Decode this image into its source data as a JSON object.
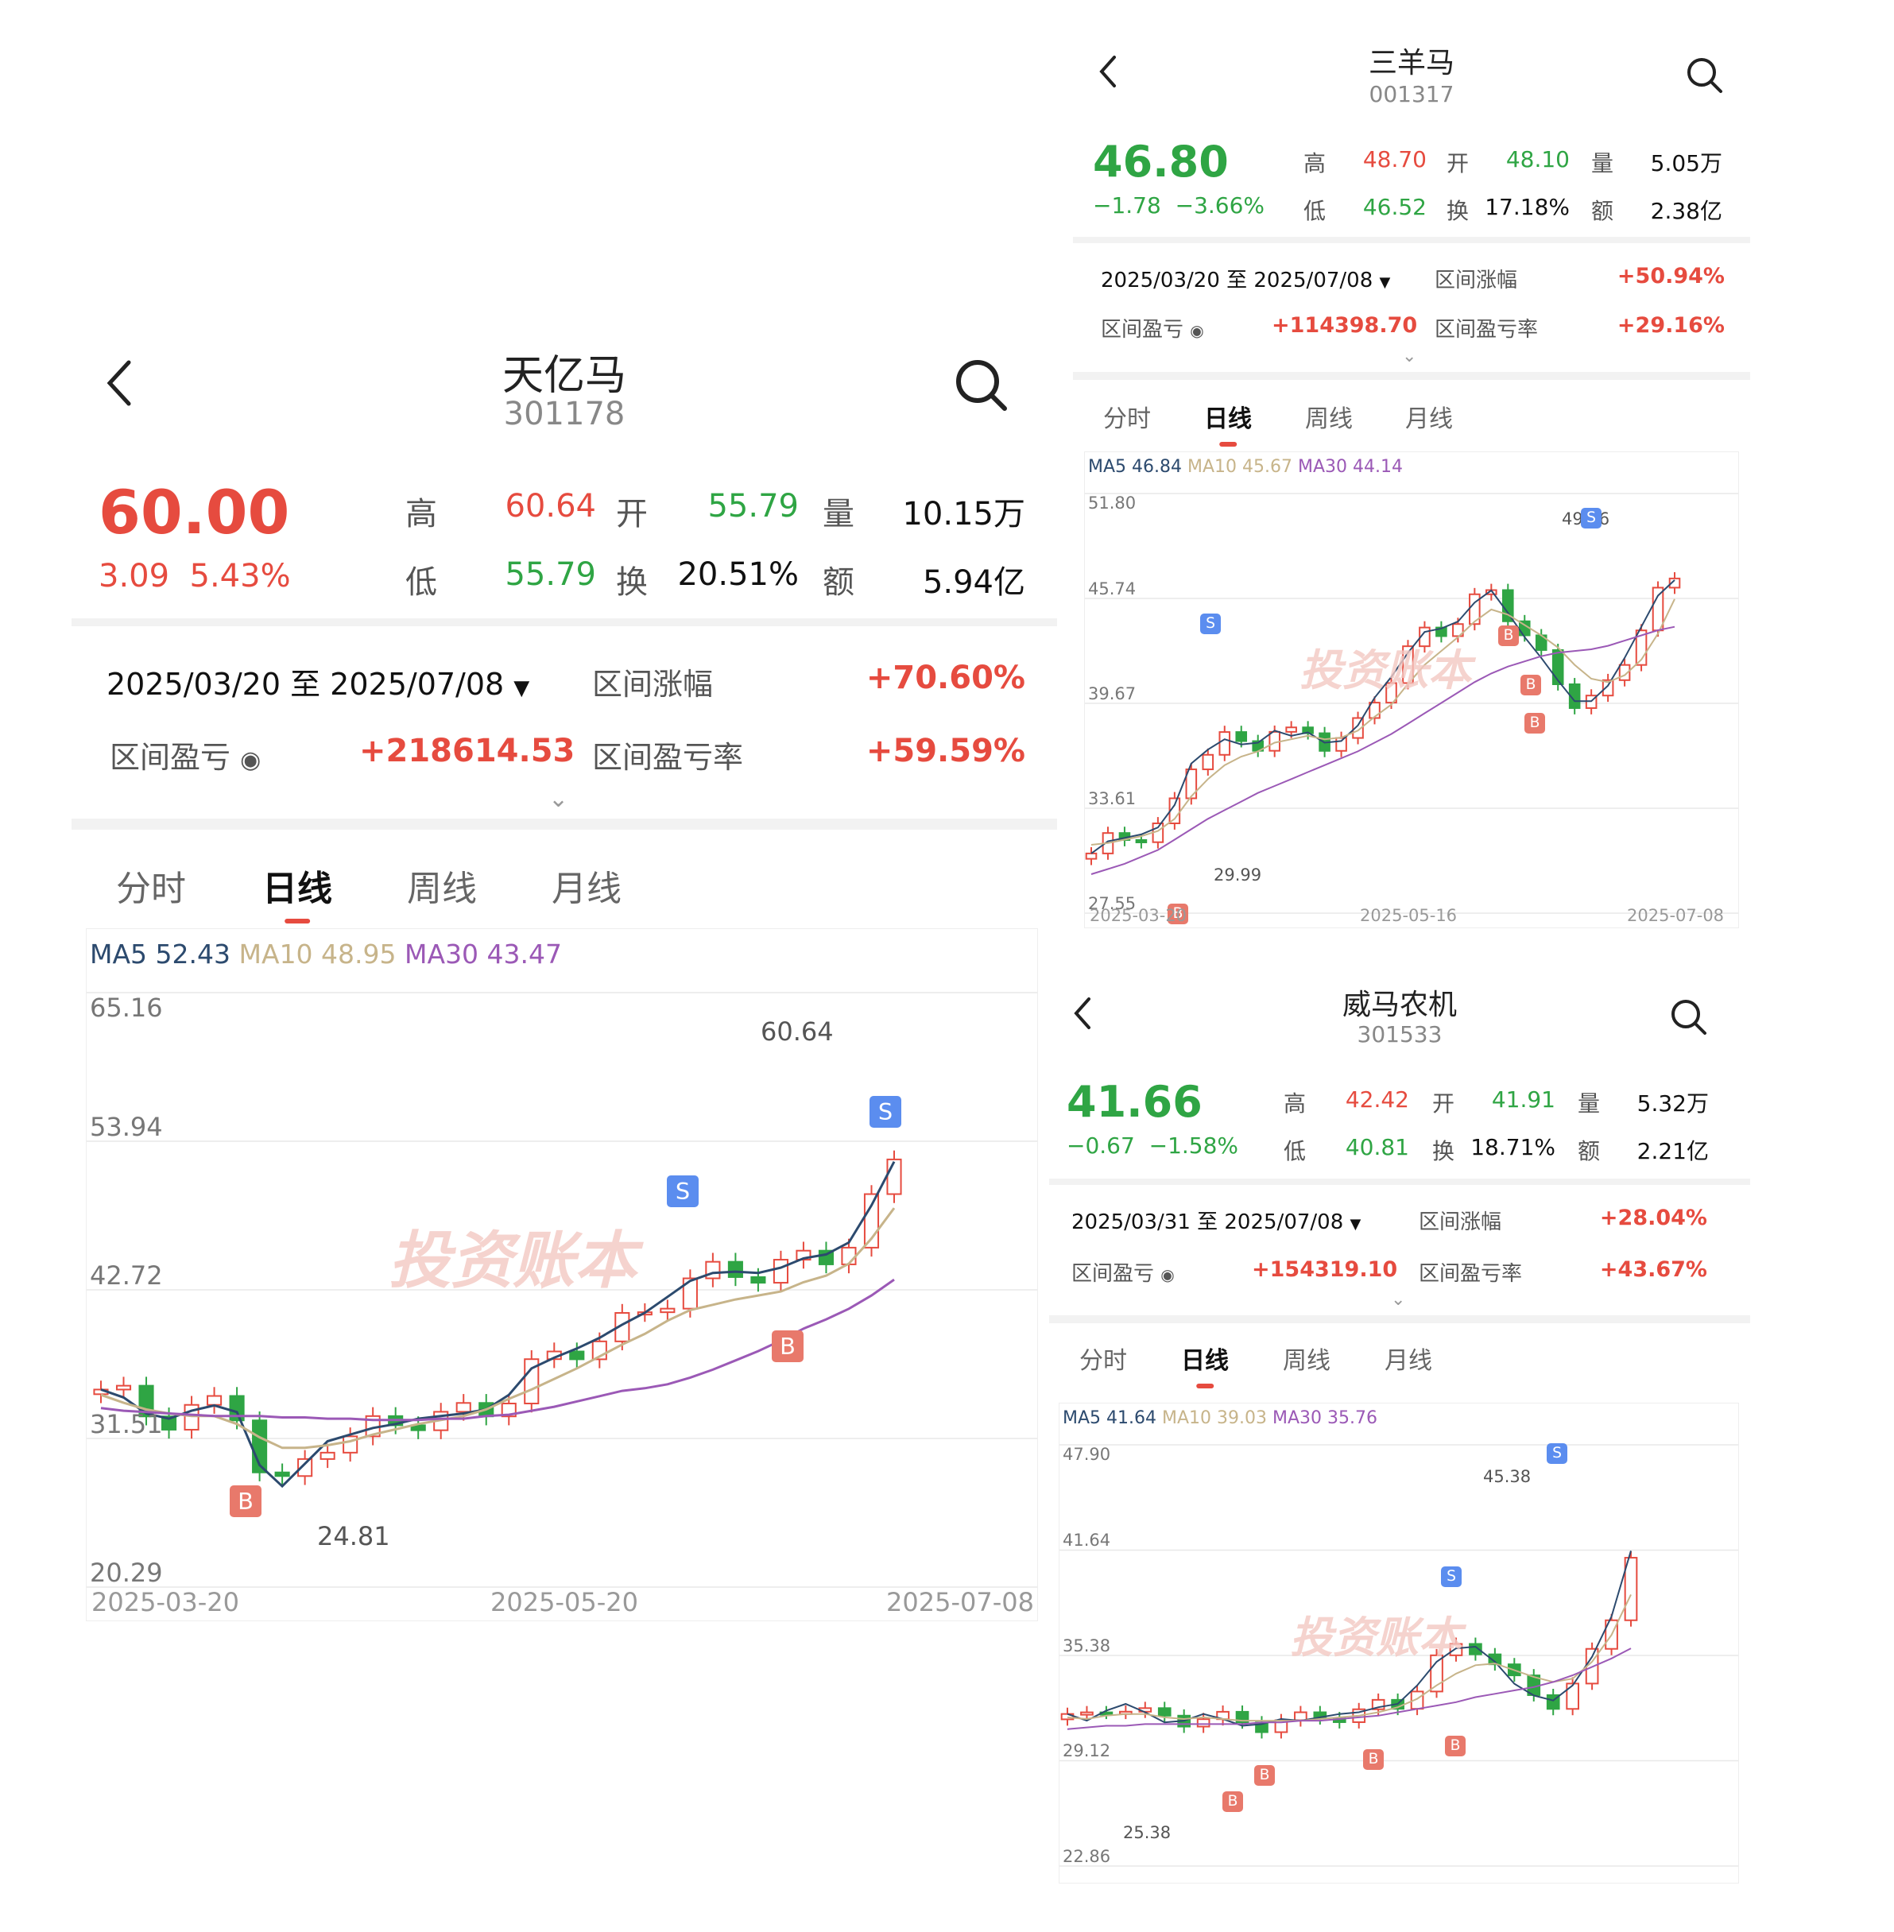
{
  "colors": {
    "up": "#e64b3f",
    "down": "#2fa544",
    "ma5": "#2c4a6e",
    "ma10": "#c7b48a",
    "ma30": "#9b59b6",
    "sell_badge": "#5b8def",
    "buy_badge": "#e8796b"
  },
  "icons": {
    "back": "chevron-left-icon",
    "search": "search-icon",
    "eye": "eye-icon",
    "range_dropdown": "triangle-down-icon",
    "expand": "chevron-down-icon"
  },
  "panel1": {
    "name": "天亿马",
    "code": "301178",
    "price": "60.00",
    "change": "3.09",
    "change_pct": "5.43%",
    "high_label": "高",
    "high": "60.64",
    "open_label": "开",
    "open": "55.79",
    "vol_label": "量",
    "vol": "10.15万",
    "low_label": "低",
    "low": "55.79",
    "turn_label": "换",
    "turn": "20.51%",
    "amt_label": "额",
    "amt": "5.94亿",
    "range": "2025/03/20 至 2025/07/08",
    "range_rise_label": "区间涨幅",
    "range_rise": "+70.60%",
    "pnl_label": "区间盈亏",
    "pnl": "+218614.53",
    "pnl_rate_label": "区间盈亏率",
    "pnl_rate": "+59.59%",
    "tabs": [
      "分时",
      "日线",
      "周线",
      "月线"
    ],
    "ma5": "MA5 52.43",
    "ma10": "MA10 48.95",
    "ma30": "MA30 43.47",
    "y_labels": [
      "65.16",
      "53.94",
      "42.72",
      "31.51",
      "20.29"
    ],
    "max_label": "60.64",
    "min_label": "24.81",
    "watermark": "投资账本",
    "dates": [
      "2025-03-20",
      "2025-05-20",
      "2025-07-08"
    ]
  },
  "panel2": {
    "name": "三羊马",
    "code": "001317",
    "price": "46.80",
    "change": "−1.78",
    "change_pct": "−3.66%",
    "high_label": "高",
    "high": "48.70",
    "open_label": "开",
    "open": "48.10",
    "vol_label": "量",
    "vol": "5.05万",
    "low_label": "低",
    "low": "46.52",
    "turn_label": "换",
    "turn": "17.18%",
    "amt_label": "额",
    "amt": "2.38亿",
    "range": "2025/03/20 至 2025/07/08",
    "range_rise_label": "区间涨幅",
    "range_rise": "+50.94%",
    "pnl_label": "区间盈亏",
    "pnl": "+114398.70",
    "pnl_rate_label": "区间盈亏率",
    "pnl_rate": "+29.16%",
    "tabs": [
      "分时",
      "日线",
      "周线",
      "月线"
    ],
    "ma5": "MA5 46.84",
    "ma10": "MA10 45.67",
    "ma30": "MA30 44.14",
    "y_labels": [
      "51.80",
      "45.74",
      "39.67",
      "33.61",
      "27.55"
    ],
    "max_label": "49.36",
    "min_label": "29.99",
    "watermark": "投资账本",
    "dates": [
      "2025-03-20",
      "2025-05-16",
      "2025-07-08"
    ]
  },
  "panel3": {
    "name": "威马农机",
    "code": "301533",
    "price": "41.66",
    "change": "−0.67",
    "change_pct": "−1.58%",
    "high_label": "高",
    "high": "42.42",
    "open_label": "开",
    "open": "41.91",
    "vol_label": "量",
    "vol": "5.32万",
    "low_label": "低",
    "low": "40.81",
    "turn_label": "换",
    "turn": "18.71%",
    "amt_label": "额",
    "amt": "2.21亿",
    "range": "2025/03/31 至 2025/07/08",
    "range_rise_label": "区间涨幅",
    "range_rise": "+28.04%",
    "pnl_label": "区间盈亏",
    "pnl": "+154319.10",
    "pnl_rate_label": "区间盈亏率",
    "pnl_rate": "+43.67%",
    "tabs": [
      "分时",
      "日线",
      "周线",
      "月线"
    ],
    "ma5": "MA5 41.64",
    "ma10": "MA10 39.03",
    "ma30": "MA30 35.76",
    "y_labels": [
      "47.90",
      "41.64",
      "35.38",
      "29.12",
      "22.86"
    ],
    "max_label": "45.38",
    "min_label": "25.38",
    "watermark": "投资账本",
    "dates": []
  },
  "chart_data": [
    {
      "type": "line",
      "title": "天亿马 301178",
      "ylim": [
        20.29,
        65.16
      ],
      "series": [
        {
          "name": "MA5",
          "values": [
            35.2,
            34.6,
            33.4,
            33.0,
            33.6,
            34.0,
            33.5,
            29.5,
            27.9,
            29.6,
            31.3,
            31.8,
            32.3,
            32.6,
            33.0,
            33.2,
            33.4,
            33.7,
            34.8,
            36.8,
            37.6,
            38.3,
            39.1,
            40.1,
            41.0,
            42.2,
            43.4,
            44.0,
            44.1,
            44.0,
            44.4,
            45.1,
            45.4,
            46.3,
            49.1,
            52.4
          ]
        },
        {
          "name": "MA10",
          "values": [
            34.8,
            34.2,
            33.7,
            33.4,
            33.2,
            33.2,
            32.6,
            31.6,
            30.8,
            30.8,
            31.0,
            31.3,
            31.8,
            32.2,
            32.6,
            32.9,
            33.2,
            33.7,
            34.5,
            35.2,
            36.0,
            36.8,
            37.7,
            38.6,
            39.4,
            40.4,
            41.2,
            41.6,
            42.0,
            42.3,
            42.6,
            43.3,
            43.8,
            44.7,
            46.6,
            48.9
          ]
        },
        {
          "name": "MA30",
          "values": [
            33.8,
            33.6,
            33.5,
            33.4,
            33.3,
            33.2,
            33.2,
            33.2,
            33.1,
            33.1,
            33.0,
            33.0,
            32.9,
            32.9,
            32.9,
            33.0,
            33.0,
            33.2,
            33.3,
            33.6,
            33.9,
            34.3,
            34.7,
            35.1,
            35.3,
            35.6,
            36.1,
            36.7,
            37.4,
            38.1,
            38.9,
            39.8,
            40.5,
            41.3,
            42.3,
            43.5
          ]
        }
      ],
      "markers": [
        {
          "label": "B",
          "price": 24.81
        },
        {
          "label": "S"
        },
        {
          "label": "B"
        },
        {
          "label": "S"
        }
      ],
      "annotations": [
        "60.64",
        "24.81"
      ]
    },
    {
      "type": "line",
      "title": "三羊马 001317",
      "ylim": [
        27.55,
        51.8
      ],
      "series": [
        {
          "name": "MA5",
          "values": [
            31.0,
            31.7,
            31.9,
            32.1,
            32.5,
            33.8,
            36.2,
            37.0,
            37.6,
            37.3,
            37.4,
            38.1,
            37.8,
            38.0,
            37.4,
            37.5,
            38.4,
            40.0,
            41.2,
            42.6,
            43.8,
            44.0,
            44.4,
            45.5,
            46.2,
            44.9,
            43.5,
            42.3,
            41.0,
            39.8,
            39.8,
            40.7,
            42.3,
            44.1,
            45.9,
            46.8
          ]
        },
        {
          "name": "MA10",
          "values": [
            31.5,
            31.6,
            31.8,
            32.0,
            32.3,
            33.0,
            34.3,
            35.3,
            36.1,
            36.6,
            36.9,
            37.4,
            37.6,
            37.8,
            37.6,
            37.7,
            38.1,
            38.9,
            39.6,
            40.8,
            41.9,
            42.7,
            43.5,
            44.4,
            45.1,
            44.8,
            44.2,
            43.6,
            42.9,
            41.9,
            41.1,
            40.9,
            41.3,
            42.2,
            43.7,
            45.7
          ]
        },
        {
          "name": "MA30",
          "values": [
            29.8,
            30.1,
            30.4,
            30.8,
            31.2,
            31.8,
            32.4,
            33.0,
            33.5,
            34.0,
            34.5,
            34.9,
            35.3,
            35.7,
            36.1,
            36.5,
            36.9,
            37.4,
            37.9,
            38.5,
            39.1,
            39.7,
            40.3,
            40.9,
            41.4,
            41.8,
            42.1,
            42.4,
            42.6,
            42.7,
            42.8,
            43.0,
            43.3,
            43.6,
            43.9,
            44.1
          ]
        }
      ],
      "markers": [
        {
          "label": "B"
        },
        {
          "label": "S"
        },
        {
          "label": "B"
        },
        {
          "label": "B"
        },
        {
          "label": "B"
        },
        {
          "label": "S"
        }
      ],
      "annotations": [
        "49.36",
        "29.99"
      ]
    },
    {
      "type": "line",
      "title": "威马农机 301533",
      "ylim": [
        22.86,
        47.9
      ],
      "series": [
        {
          "name": "MA5",
          "values": [
            31.9,
            31.5,
            32.1,
            32.5,
            32.0,
            31.4,
            31.5,
            31.9,
            31.6,
            31.2,
            31.3,
            31.6,
            31.5,
            31.7,
            31.9,
            32.0,
            32.3,
            32.5,
            33.6,
            35.0,
            35.8,
            35.9,
            35.0,
            33.7,
            33.0,
            32.7,
            33.6,
            35.3,
            37.7,
            41.6
          ]
        },
        {
          "name": "MA10",
          "values": [
            31.7,
            31.6,
            31.8,
            31.9,
            31.9,
            31.7,
            31.6,
            31.7,
            31.6,
            31.5,
            31.5,
            31.5,
            31.5,
            31.6,
            31.7,
            31.8,
            32.0,
            32.3,
            32.8,
            33.6,
            34.3,
            34.8,
            34.9,
            34.5,
            34.1,
            33.8,
            34.0,
            35.0,
            36.6,
            39.0
          ]
        },
        {
          "name": "MA30",
          "values": [
            31.0,
            31.1,
            31.2,
            31.2,
            31.3,
            31.3,
            31.3,
            31.3,
            31.3,
            31.3,
            31.4,
            31.4,
            31.5,
            31.5,
            31.6,
            31.7,
            31.8,
            32.0,
            32.2,
            32.4,
            32.6,
            32.9,
            33.1,
            33.3,
            33.5,
            33.8,
            34.2,
            34.7,
            35.2,
            35.8
          ]
        }
      ],
      "markers": [
        {
          "label": "B"
        },
        {
          "label": "B"
        },
        {
          "label": "B"
        },
        {
          "label": "S"
        },
        {
          "label": "B"
        },
        {
          "label": "S"
        }
      ],
      "annotations": [
        "45.38",
        "25.38"
      ]
    }
  ]
}
